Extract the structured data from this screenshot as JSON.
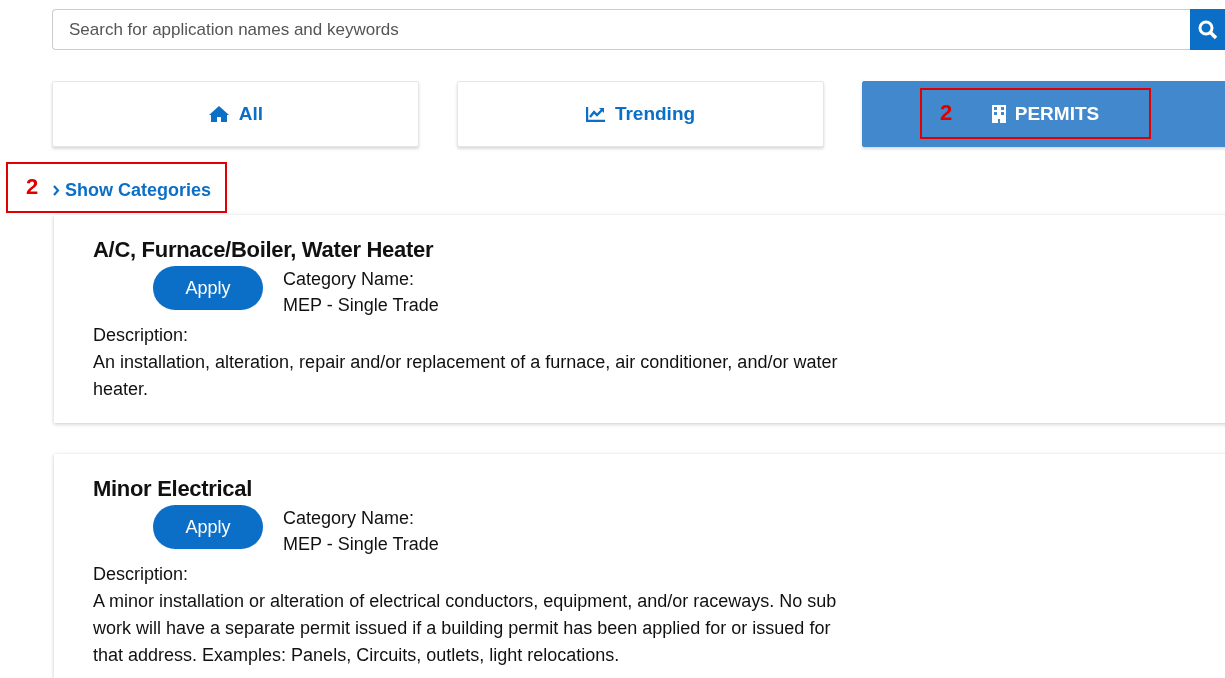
{
  "search": {
    "placeholder": "Search for application names and keywords"
  },
  "tabs": [
    {
      "label": "All",
      "selected": false
    },
    {
      "label": "Trending",
      "selected": false
    },
    {
      "label": "PERMITS",
      "selected": true
    }
  ],
  "categories_toggle": {
    "label": "Show Categories",
    "expanded": false
  },
  "results": [
    {
      "title": "A/C, Furnace/Boiler, Water Heater",
      "button": "Apply",
      "category_label": "Category Name:",
      "category": "MEP - Single Trade",
      "description_label": "Description:",
      "description": "An installation, alteration, repair and/or replacement of a furnace, air conditioner, and/or water heater."
    },
    {
      "title": "Minor Electrical",
      "button": "Apply",
      "category_label": "Category Name:",
      "category": "MEP - Single Trade",
      "description_label": "Description:",
      "description": "A minor installation or alteration of electrical conductors, equipment, and/or raceways. No sub work will have a separate permit issued if a building permit has been applied for or issued for that address. Examples: Panels, Circuits, outlets, light relocations."
    }
  ],
  "annotations": [
    {
      "label": "2"
    },
    {
      "label": "2"
    }
  ]
}
